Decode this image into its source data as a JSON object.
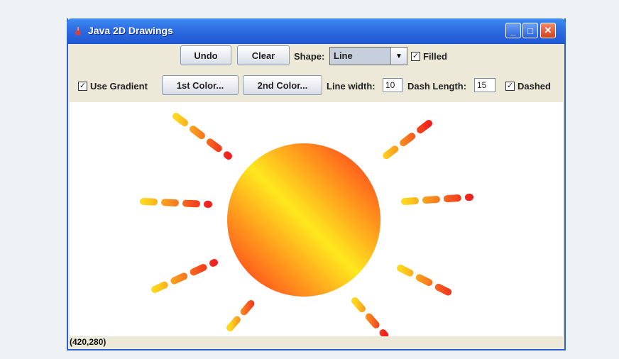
{
  "window": {
    "title": "Java 2D Drawings",
    "controls": [
      "_",
      "□",
      "✕"
    ]
  },
  "toolbar1": {
    "undo_label": "Undo",
    "clear_label": "Clear",
    "shape_label": "Shape:",
    "shape_value": "Line",
    "filled_label": "Filled",
    "filled_checked": "✓"
  },
  "toolbar2": {
    "use_gradient_label": "Use Gradient",
    "use_gradient_checked": "✓",
    "color1_label": "1st Color...",
    "color2_label": "2nd Color...",
    "line_width_label": "Line width:",
    "line_width_value": "10",
    "dash_length_label": "Dash Length:",
    "dash_length_value": "15",
    "dashed_label": "Dashed",
    "dashed_checked": "✓"
  },
  "status": {
    "text": "(420,280)"
  },
  "colors": {
    "gradient_1": "#f0201e",
    "gradient_2": "#ffe81e",
    "title_bar": "#2f6fe3"
  },
  "icons": {
    "app": "java-cup-icon",
    "combo_arrow": "chevron-down-icon"
  }
}
